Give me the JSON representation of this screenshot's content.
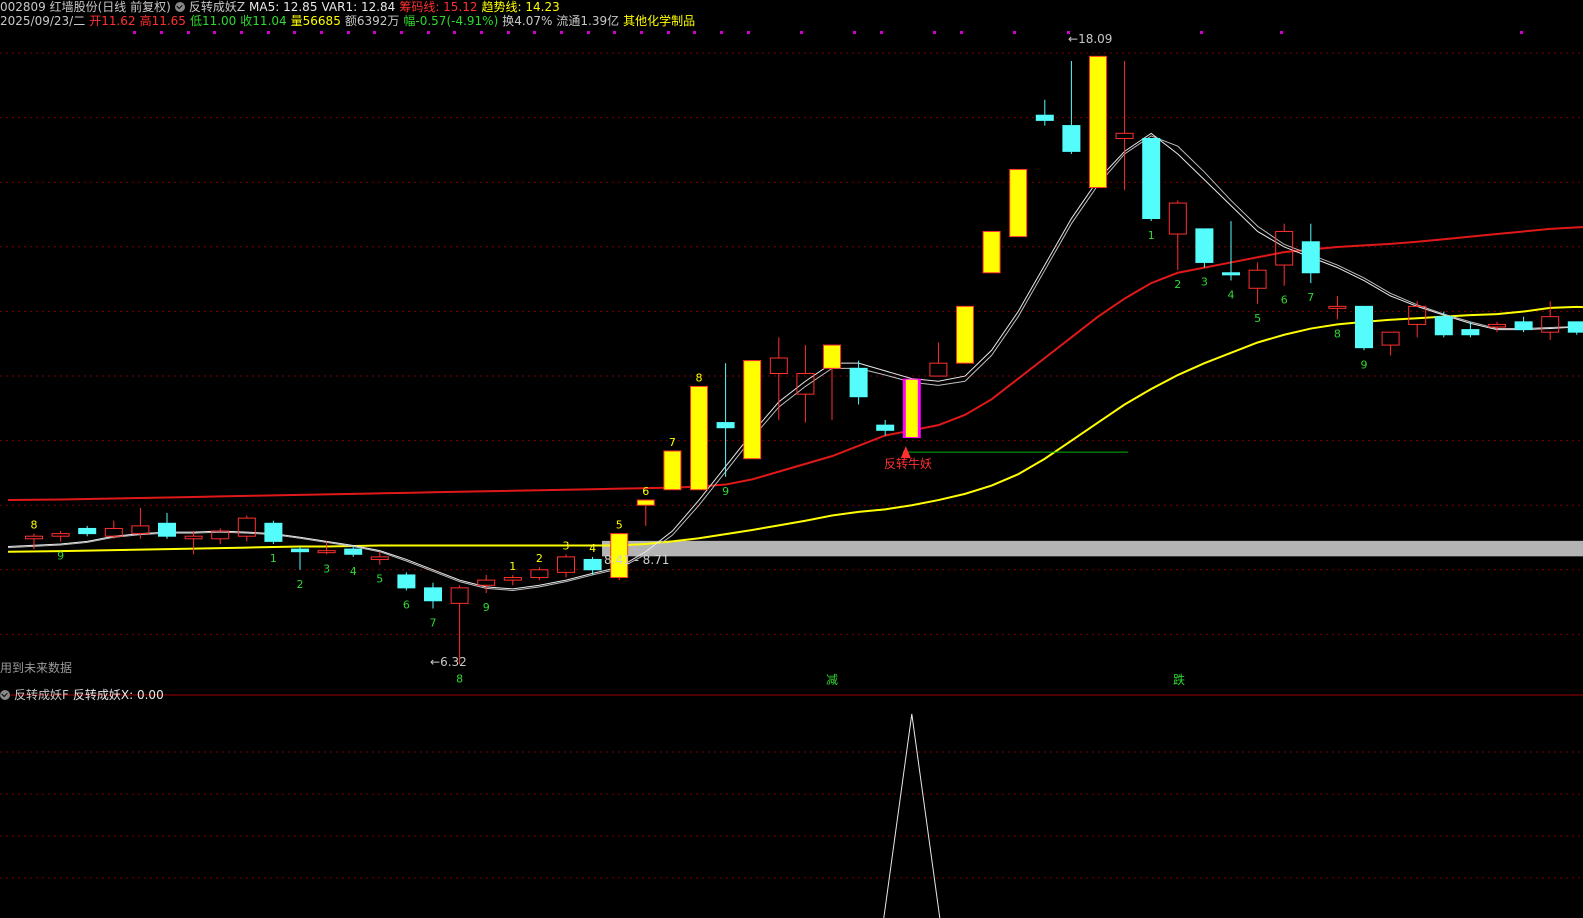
{
  "header": {
    "code_name": "002809 红墙股份(日线 前复权)",
    "indicator_name": "反转成妖Z",
    "ma5": "MA5: 12.85",
    "var1": "VAR1: 12.84",
    "chip_line": "筹码线: 15.12",
    "trend_line": "趋势线: 14.23",
    "date": "2025/09/23/二",
    "open": "开11.62",
    "high": "高11.65",
    "low": "低11.00",
    "close": "收11.04",
    "volume": "量56685",
    "amount": "额6392万",
    "change": "幅-0.57(-4.91%)",
    "turnover": "换4.07%",
    "float_cap": "流通1.39亿",
    "sector": "其他化学制品"
  },
  "overlay": {
    "future_data_note": "用到未来数据",
    "reverse_label": "反转牛妖",
    "high_price": "18.09",
    "low_price": "6.32",
    "band_label": "8.41 - 8.71",
    "reduce_label": "减",
    "drop_label": "跌"
  },
  "sub_panel": {
    "indicator_name": "反转成妖F",
    "value_label": "反转成妖X: 0.00"
  },
  "colors": {
    "up": "#ff3030",
    "down": "#54fcfc",
    "yellow": "#ffff00",
    "red_ma": "#e01818",
    "white_ma": "#e8e8e8",
    "grid": "#7a0000",
    "count_green": "#2fd82f",
    "count_yellow": "#ffff00",
    "band_gray": "#b4b4b4"
  },
  "chart_data": {
    "type": "candlestick",
    "price_range": [
      5.9,
      18.6
    ],
    "candles": [
      {
        "o": 8.75,
        "h": 8.85,
        "l": 8.55,
        "c": 8.8,
        "k": "up",
        "n": "8",
        "nc": "y"
      },
      {
        "o": 8.8,
        "h": 8.9,
        "l": 8.7,
        "c": 8.85,
        "k": "up",
        "n": "9",
        "nc": "g"
      },
      {
        "o": 8.95,
        "h": 9.0,
        "l": 8.8,
        "c": 8.85,
        "k": "dn"
      },
      {
        "o": 8.8,
        "h": 9.1,
        "l": 8.75,
        "c": 8.95,
        "k": "up"
      },
      {
        "o": 8.85,
        "h": 9.35,
        "l": 8.75,
        "c": 9.0,
        "k": "up"
      },
      {
        "o": 9.05,
        "h": 9.25,
        "l": 8.75,
        "c": 8.8,
        "k": "dn"
      },
      {
        "o": 8.8,
        "h": 8.9,
        "l": 8.45,
        "c": 8.75,
        "k": "up"
      },
      {
        "o": 8.75,
        "h": 8.95,
        "l": 8.65,
        "c": 8.9,
        "k": "up"
      },
      {
        "o": 8.8,
        "h": 9.2,
        "l": 8.7,
        "c": 9.15,
        "k": "up"
      },
      {
        "o": 9.05,
        "h": 9.1,
        "l": 8.65,
        "c": 8.7,
        "k": "dn",
        "n": "1",
        "nc": "g"
      },
      {
        "o": 8.55,
        "h": 8.6,
        "l": 8.15,
        "c": 8.5,
        "k": "dn",
        "n": "2",
        "nc": "g"
      },
      {
        "o": 8.5,
        "h": 8.7,
        "l": 8.45,
        "c": 8.52,
        "k": "up",
        "n": "3",
        "nc": "g"
      },
      {
        "o": 8.55,
        "h": 8.6,
        "l": 8.4,
        "c": 8.45,
        "k": "dn",
        "n": "4",
        "nc": "g"
      },
      {
        "o": 8.35,
        "h": 8.5,
        "l": 8.25,
        "c": 8.4,
        "k": "up",
        "n": "5",
        "nc": "g"
      },
      {
        "o": 8.05,
        "h": 8.1,
        "l": 7.75,
        "c": 7.8,
        "k": "dn",
        "n": "6",
        "nc": "g"
      },
      {
        "o": 7.8,
        "h": 7.9,
        "l": 7.4,
        "c": 7.55,
        "k": "dn",
        "n": "7",
        "nc": "g"
      },
      {
        "o": 7.5,
        "h": 7.85,
        "l": 6.32,
        "c": 7.8,
        "k": "up",
        "n": "8",
        "nc": "g"
      },
      {
        "o": 7.85,
        "h": 8.05,
        "l": 7.7,
        "c": 7.95,
        "k": "up",
        "n": "9",
        "nc": "g"
      },
      {
        "o": 7.95,
        "h": 8.05,
        "l": 7.85,
        "c": 8.0,
        "k": "up",
        "n": "1",
        "nc": "y"
      },
      {
        "o": 8.0,
        "h": 8.2,
        "l": 7.95,
        "c": 8.15,
        "k": "up",
        "n": "2",
        "nc": "y"
      },
      {
        "o": 8.1,
        "h": 8.45,
        "l": 8.0,
        "c": 8.4,
        "k": "up",
        "n": "3",
        "nc": "y"
      },
      {
        "o": 8.35,
        "h": 8.4,
        "l": 8.05,
        "c": 8.15,
        "k": "dn",
        "n": "4",
        "nc": "y"
      },
      {
        "o": 8.0,
        "h": 8.85,
        "l": 7.95,
        "c": 8.85,
        "k": "yel",
        "n": "5",
        "nc": "y"
      },
      {
        "o": 9.4,
        "h": 9.5,
        "l": 9.0,
        "c": 9.5,
        "k": "yel",
        "n": "6",
        "nc": "y"
      },
      {
        "o": 9.7,
        "h": 10.45,
        "l": 9.7,
        "c": 10.45,
        "k": "yel",
        "n": "7",
        "nc": "y"
      },
      {
        "o": 9.7,
        "h": 11.7,
        "l": 9.7,
        "c": 11.7,
        "k": "yel",
        "n": "8",
        "nc": "y"
      },
      {
        "o": 11.0,
        "h": 12.15,
        "l": 9.95,
        "c": 10.9,
        "k": "dn",
        "n": "9",
        "nc": "g"
      },
      {
        "o": 10.3,
        "h": 12.2,
        "l": 10.3,
        "c": 12.2,
        "k": "yel"
      },
      {
        "o": 11.95,
        "h": 12.65,
        "l": 11.05,
        "c": 12.25,
        "k": "up"
      },
      {
        "o": 11.55,
        "h": 12.5,
        "l": 11.0,
        "c": 11.95,
        "k": "up"
      },
      {
        "o": 12.05,
        "h": 12.5,
        "l": 11.05,
        "c": 12.5,
        "k": "yel"
      },
      {
        "o": 12.05,
        "h": 12.2,
        "l": 11.35,
        "c": 11.5,
        "k": "dn"
      },
      {
        "o": 10.95,
        "h": 11.05,
        "l": 10.75,
        "c": 10.85,
        "k": "dn"
      },
      {
        "o": 10.7,
        "h": 11.85,
        "l": 10.7,
        "c": 11.85,
        "k": "mag"
      },
      {
        "o": 11.9,
        "h": 12.55,
        "l": 11.9,
        "c": 12.15,
        "k": "up"
      },
      {
        "o": 12.15,
        "h": 13.25,
        "l": 12.15,
        "c": 13.25,
        "k": "yel"
      },
      {
        "o": 13.9,
        "h": 14.7,
        "l": 13.9,
        "c": 14.7,
        "k": "yel"
      },
      {
        "o": 14.6,
        "h": 15.9,
        "l": 14.6,
        "c": 15.9,
        "k": "yel"
      },
      {
        "o": 16.95,
        "h": 17.25,
        "l": 16.75,
        "c": 16.85,
        "k": "dn"
      },
      {
        "o": 16.75,
        "h": 18.0,
        "l": 16.2,
        "c": 16.25,
        "k": "dn"
      },
      {
        "o": 15.55,
        "h": 18.09,
        "l": 15.55,
        "c": 18.09,
        "k": "yel"
      },
      {
        "o": 16.5,
        "h": 18.0,
        "l": 15.5,
        "c": 16.6,
        "k": "up"
      },
      {
        "o": 16.5,
        "h": 16.5,
        "l": 14.9,
        "c": 14.95,
        "k": "dn",
        "n": "1",
        "nc": "g"
      },
      {
        "o": 14.65,
        "h": 15.3,
        "l": 13.95,
        "c": 15.25,
        "k": "up",
        "n": "2",
        "nc": "g"
      },
      {
        "o": 14.75,
        "h": 14.75,
        "l": 14.0,
        "c": 14.1,
        "k": "dn",
        "n": "3",
        "nc": "g"
      },
      {
        "o": 13.9,
        "h": 14.9,
        "l": 13.75,
        "c": 13.86,
        "k": "dn",
        "n": "4",
        "nc": "g"
      },
      {
        "o": 13.6,
        "h": 14.1,
        "l": 13.3,
        "c": 13.95,
        "k": "up",
        "n": "5",
        "nc": "g"
      },
      {
        "o": 14.05,
        "h": 14.85,
        "l": 13.65,
        "c": 14.7,
        "k": "up",
        "n": "6",
        "nc": "g"
      },
      {
        "o": 14.5,
        "h": 14.85,
        "l": 13.7,
        "c": 13.9,
        "k": "dn",
        "n": "7",
        "nc": "g"
      },
      {
        "o": 13.22,
        "h": 13.45,
        "l": 13.0,
        "c": 13.25,
        "k": "up",
        "n": "8",
        "nc": "g"
      },
      {
        "o": 13.25,
        "h": 13.25,
        "l": 12.4,
        "c": 12.45,
        "k": "dn",
        "n": "9",
        "nc": "g"
      },
      {
        "o": 12.5,
        "h": 12.75,
        "l": 12.3,
        "c": 12.75,
        "k": "up"
      },
      {
        "o": 12.9,
        "h": 13.35,
        "l": 12.65,
        "c": 13.25,
        "k": "up"
      },
      {
        "o": 13.05,
        "h": 13.15,
        "l": 12.65,
        "c": 12.7,
        "k": "dn"
      },
      {
        "o": 12.8,
        "h": 12.95,
        "l": 12.65,
        "c": 12.7,
        "k": "dn"
      },
      {
        "o": 12.85,
        "h": 12.95,
        "l": 12.75,
        "c": 12.9,
        "k": "up"
      },
      {
        "o": 12.95,
        "h": 13.05,
        "l": 12.75,
        "c": 12.8,
        "k": "dn"
      },
      {
        "o": 12.75,
        "h": 13.35,
        "l": 12.6,
        "c": 13.05,
        "k": "up"
      },
      {
        "o": 12.95,
        "h": 12.95,
        "l": 12.7,
        "c": 12.75,
        "k": "dn"
      },
      {
        "o": 12.65,
        "h": 12.7,
        "l": 12.25,
        "c": 12.4,
        "k": "dn"
      }
    ],
    "lines": {
      "trend_yellow": [
        8.5,
        8.51,
        8.52,
        8.53,
        8.54,
        8.55,
        8.56,
        8.57,
        8.58,
        8.59,
        8.6,
        8.6,
        8.61,
        8.62,
        8.62,
        8.62,
        8.62,
        8.62,
        8.62,
        8.62,
        8.62,
        8.62,
        8.62,
        8.65,
        8.7,
        8.76,
        8.84,
        8.92,
        9.01,
        9.1,
        9.2,
        9.27,
        9.32,
        9.4,
        9.5,
        9.62,
        9.78,
        10.0,
        10.3,
        10.65,
        11.0,
        11.35,
        11.65,
        11.92,
        12.15,
        12.35,
        12.55,
        12.7,
        12.82,
        12.9,
        12.95,
        12.99,
        13.02,
        13.05,
        13.08,
        13.1,
        13.15,
        13.22,
        13.24,
        13.22
      ],
      "chip_red": [
        9.5,
        9.51,
        9.52,
        9.53,
        9.54,
        9.55,
        9.56,
        9.57,
        9.58,
        9.59,
        9.6,
        9.61,
        9.62,
        9.63,
        9.64,
        9.65,
        9.66,
        9.67,
        9.68,
        9.69,
        9.7,
        9.71,
        9.72,
        9.73,
        9.74,
        9.76,
        9.8,
        9.9,
        10.05,
        10.2,
        10.35,
        10.55,
        10.75,
        10.85,
        10.95,
        11.15,
        11.45,
        11.85,
        12.25,
        12.65,
        13.05,
        13.4,
        13.7,
        13.9,
        14.0,
        14.1,
        14.2,
        14.3,
        14.35,
        14.4,
        14.43,
        14.46,
        14.5,
        14.55,
        14.6,
        14.65,
        14.7,
        14.75,
        14.78,
        14.8
      ],
      "ma5_white": [
        8.6,
        8.65,
        8.7,
        8.8,
        8.85,
        8.88,
        8.88,
        8.9,
        8.88,
        8.85,
        8.78,
        8.7,
        8.62,
        8.52,
        8.35,
        8.15,
        7.95,
        7.82,
        7.78,
        7.85,
        7.95,
        8.08,
        8.2,
        8.5,
        8.9,
        9.5,
        10.15,
        10.8,
        11.4,
        11.8,
        12.15,
        12.15,
        12.0,
        11.85,
        11.8,
        11.9,
        12.4,
        13.15,
        14.05,
        14.95,
        15.7,
        16.25,
        16.6,
        16.2,
        15.7,
        15.2,
        14.7,
        14.4,
        14.2,
        14.0,
        13.75,
        13.45,
        13.25,
        13.08,
        12.92,
        12.8,
        12.8,
        12.82,
        12.85,
        12.8
      ],
      "var1_white": [
        8.58,
        8.63,
        8.68,
        8.78,
        8.83,
        8.86,
        8.86,
        8.88,
        8.86,
        8.83,
        8.76,
        8.68,
        8.6,
        8.5,
        8.32,
        8.12,
        7.92,
        7.79,
        7.75,
        7.82,
        7.92,
        8.05,
        8.17,
        8.45,
        8.82,
        9.4,
        10.05,
        10.7,
        11.3,
        11.7,
        12.05,
        12.05,
        11.92,
        11.78,
        11.72,
        11.8,
        12.3,
        13.05,
        13.95,
        14.85,
        15.6,
        16.2,
        16.55,
        16.35,
        15.85,
        15.3,
        14.8,
        14.45,
        14.25,
        14.05,
        13.8,
        13.5,
        13.28,
        13.1,
        12.95,
        12.82,
        12.82,
        12.84,
        12.86,
        12.82
      ]
    },
    "sub_series": {
      "peak_index": 33,
      "peak_value": 1,
      "baseline": 0
    }
  }
}
